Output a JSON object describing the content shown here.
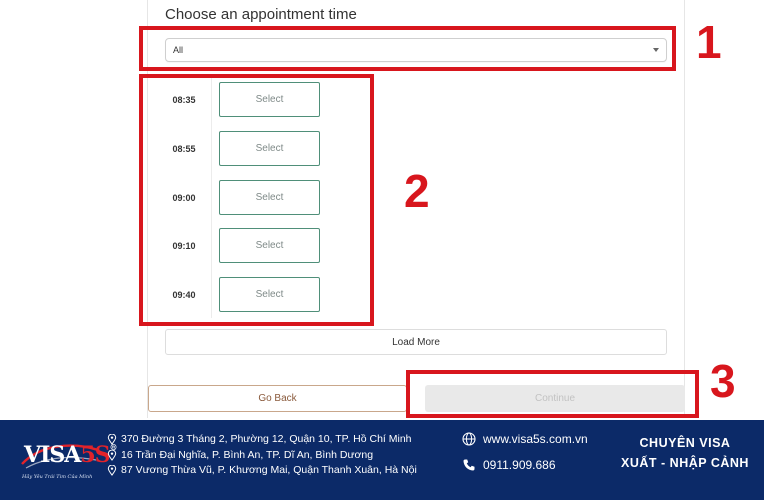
{
  "section_title": "Choose an appointment time",
  "filter": {
    "selected": "All"
  },
  "slots": [
    {
      "time": "08:35",
      "action": "Select"
    },
    {
      "time": "08:55",
      "action": "Select"
    },
    {
      "time": "09:00",
      "action": "Select"
    },
    {
      "time": "09:10",
      "action": "Select"
    },
    {
      "time": "09:40",
      "action": "Select"
    }
  ],
  "load_more_label": "Load More",
  "go_back_label": "Go Back",
  "continue_label": "Continue",
  "annotations": [
    "1",
    "2",
    "3"
  ],
  "colors": {
    "annotation_red": "#d8161d",
    "footer_blue": "#0c2a68",
    "slot_border": "#4f8f79",
    "logo_red": "#e2232a"
  },
  "footer": {
    "logo": {
      "text_main": "VISA",
      "text_accent": "5S",
      "registered": "®",
      "tagline": "Hãy Yêu Trái Tim Của Mình"
    },
    "addresses": [
      "370 Đường 3 Tháng 2, Phường 12, Quận 10, TP. Hồ Chí Minh",
      "16 Trần Đại Nghĩa, P. Bình An, TP. Dĩ An, Bình Dương",
      "87 Vương Thừa Vũ, P. Khương Mai, Quận Thanh Xuân, Hà Nội"
    ],
    "website": "www.visa5s.com.vn",
    "phone": "0911.909.686",
    "tagline_line1": "CHUYÊN VISA",
    "tagline_line2": "XUẤT - NHẬP CẢNH"
  }
}
